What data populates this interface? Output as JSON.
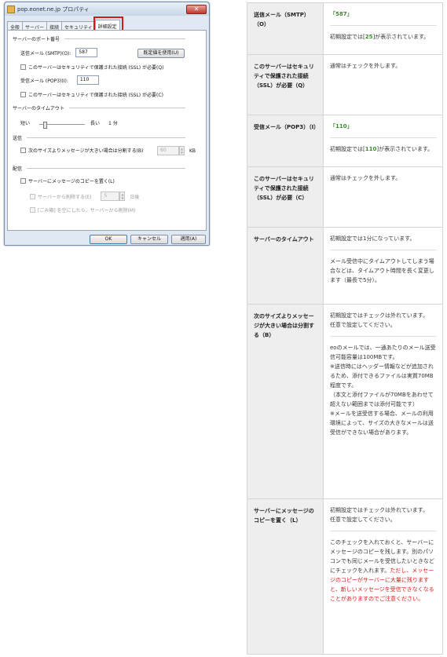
{
  "dialog": {
    "title": "pop.eonet.ne.jp プロパティ",
    "close_glyph": "✕",
    "tabs": [
      "全般",
      "サーバー",
      "接続",
      "セキュリティ",
      "詳細設定"
    ],
    "active_tab": "詳細設定",
    "highlight_color": "#d31a1a",
    "group_ports": "サーバーのポート番号",
    "smtp_label": "送信メール (SMTP)(O):",
    "smtp_value": "587",
    "default_button": "既定値を使用(U)",
    "ssl_smtp_label": "このサーバーはセキュリティで保護された接続 (SSL) が必要(Q)",
    "pop3_label": "受信メール (POP3)(I):",
    "pop3_value": "110",
    "ssl_pop3_label": "このサーバーはセキュリティで保護された接続 (SSL) が必要(C)",
    "group_timeout": "サーバーのタイムアウト",
    "timeout_short": "短い",
    "timeout_long": "長い",
    "timeout_value": "1 分",
    "timeout_level": 0.1,
    "group_send": "送信",
    "split_label": "次のサイズよりメッセージが大きい場合は分割する(B)",
    "split_value": "60",
    "split_unit": "KB",
    "group_delivery": "配信",
    "keep_copy_label": "サーバーにメッセージのコピーを置く(L)",
    "remove_after_label": "サーバーから削除する(E)",
    "remove_after_value": "5",
    "remove_after_unit": "日後",
    "remove_deleted_label": "[ごみ箱] を空にしたら、サーバーから削除(M)",
    "ok": "OK",
    "cancel": "キャンセル",
    "apply": "適用(A)"
  },
  "table": {
    "rows": [
      {
        "label": "送信メール（SMTP）（O）",
        "value_line": "「587」",
        "note_pre": "初期設定では[",
        "note_val": "25",
        "note_post": "]が表示されています。"
      },
      {
        "label": "このサーバーはセキュリティで保護された接続（SSL）が必要（Q）",
        "text": "通常はチェックを外します。"
      },
      {
        "label": "受信メール（POP3）（I）",
        "value_line": "「110」",
        "note_pre": "初期設定では[",
        "note_val": "110",
        "note_post": "]が表示されています。"
      },
      {
        "label": "このサーバーはセキュリティで保護された接続（SSL）が必要（C）",
        "text": "通常はチェックを外します。"
      },
      {
        "label": "サーバーのタイムアウト",
        "text1": "初期設定では1分になっています。",
        "text2": "メール受信中にタイムアウトしてしまう場合などは、タイムアウト時間を長く変更します（最長で5分）。"
      },
      {
        "label": "次のサイズよりメッセージが大きい場合は分割する（B）",
        "text1a": "初期設定ではチェックは外れています。",
        "text1b": "任意で設定してください。",
        "text2a": "eoのメールでは、一通あたりのメール送受信可能容量は100MBです。",
        "text2b": "※送信時にはヘッダー情報などが追加されるため、添付できるファイルは実質70MB程度です。",
        "text2c": "（本文と添付ファイルが70MBをあわせて超えない範囲までは添付可能です）",
        "text2d": "※メールを送受信する場合、メールの利用環境によって、サイズの大きなメールは送受信ができない場合があります。"
      },
      {
        "label": "サーバーにメッセージのコピーを置く（L）",
        "text1a": "初期設定ではチェックは外れています。",
        "text1b": "任意で設定してください。",
        "text2": "このチェックを入れておくと、サーバーにメッセージのコピーを残します。別のパソコンでも同じメールを受信したいときなどにチェックを入れます。",
        "text2_red": "ただし、メッセージのコピーがサーバーに大量に残りますと、新しいメッセージを受信できなくなることがありますのでご注意ください。"
      }
    ]
  }
}
